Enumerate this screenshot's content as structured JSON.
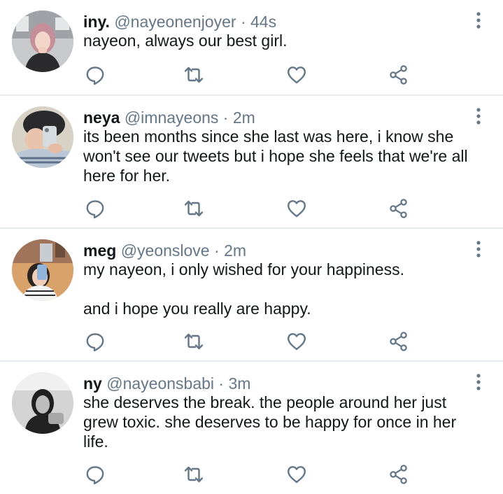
{
  "colors": {
    "text": "#14171a",
    "secondary": "#657786",
    "icon": "#657786",
    "divider": "#e6ecf0"
  },
  "tweets": [
    {
      "name": "iny.",
      "handle": "@nayeonenjoyer",
      "separator": "·",
      "time": "44s",
      "paragraphs": [
        "nayeon, always our best girl."
      ],
      "icons": [
        "reply-icon",
        "retweet-icon",
        "like-icon",
        "share-icon"
      ]
    },
    {
      "name": "neya",
      "handle": "@imnayeons",
      "separator": "·",
      "time": "2m",
      "paragraphs": [
        "its been months since she last was here, i know she won't see our tweets but i hope she feels that we're all here for her."
      ],
      "icons": [
        "reply-icon",
        "retweet-icon",
        "like-icon",
        "share-icon"
      ]
    },
    {
      "name": "meg",
      "handle": "@yeonslove",
      "separator": "·",
      "time": "2m",
      "paragraphs": [
        "my nayeon, i only wished for your happiness.",
        "and i hope you really are happy."
      ],
      "icons": [
        "reply-icon",
        "retweet-icon",
        "like-icon",
        "share-icon"
      ]
    },
    {
      "name": "ny",
      "handle": "@nayeonsbabi",
      "separator": "·",
      "time": "3m",
      "paragraphs": [
        "she deserves the break. the people around her just grew toxic. she deserves to be happy for once in her life."
      ],
      "icons": [
        "reply-icon",
        "retweet-icon",
        "like-icon",
        "share-icon"
      ]
    }
  ]
}
